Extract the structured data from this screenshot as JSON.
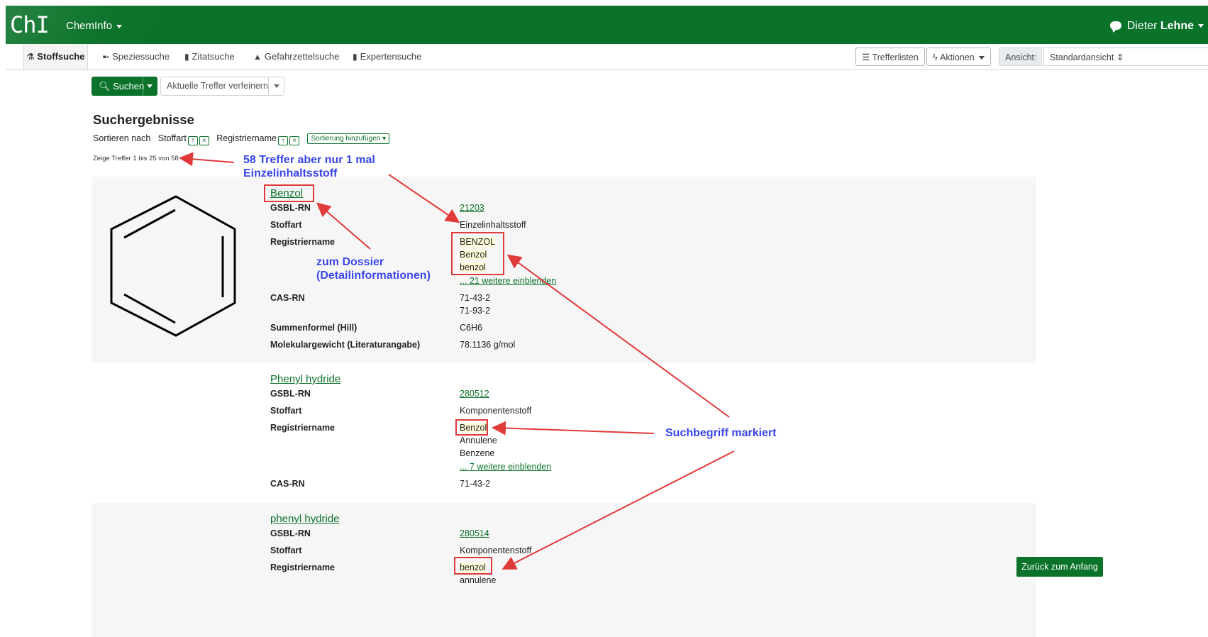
{
  "header": {
    "logo": "ChI",
    "brand": "ChemInfo",
    "user_first": "Dieter",
    "user_last": "Lehne"
  },
  "tabs": [
    {
      "label": "Stoffsuche",
      "icon": "flask-icon"
    },
    {
      "label": "Speziessuche",
      "icon": "fish-icon"
    },
    {
      "label": "Zitatsuche",
      "icon": "book-icon"
    },
    {
      "label": "Gefahrzettelsuche",
      "icon": "warning-icon"
    },
    {
      "label": "Expertensuche",
      "icon": "book-icon"
    }
  ],
  "toolbar": {
    "trefferlisten": "Trefferlisten",
    "aktionen": "Aktionen",
    "ansicht_label": "Ansicht:",
    "ansicht_value": "Standardansicht"
  },
  "search": {
    "button": "Suchen",
    "refine": "Aktuelle Treffer verfeinern"
  },
  "results_header": {
    "title": "Suchergebnisse",
    "sort_by": "Sortieren nach",
    "sort1": "Stoffart",
    "sort2": "Registriername",
    "add_sort": "Sortierung hinzufügen",
    "count": "Zeige Treffer 1 bis 25 von 58"
  },
  "results": [
    {
      "title": "Benzol",
      "rows": [
        {
          "label": "GSBL-RN",
          "values": [
            "21203"
          ]
        },
        {
          "label": "Stoffart",
          "values": [
            "Einzelinhaltsstoff"
          ]
        },
        {
          "label": "Registriername",
          "values": [
            "BENZOL",
            "Benzol",
            "benzol"
          ],
          "more": "... 21 weitere einblenden"
        },
        {
          "label": "CAS-RN",
          "values": [
            "71-43-2",
            "71-93-2"
          ]
        },
        {
          "label": "Summenformel (Hill)",
          "values": [
            "C6H6"
          ]
        },
        {
          "label": "Molekulargewicht (Literaturangabe)",
          "values": [
            "78.1136 g/mol"
          ]
        }
      ]
    },
    {
      "title": "Phenyl hydride",
      "rows": [
        {
          "label": "GSBL-RN",
          "values": [
            "280512"
          ]
        },
        {
          "label": "Stoffart",
          "values": [
            "Komponentenstoff"
          ]
        },
        {
          "label": "Registriername",
          "values": [
            "Benzol",
            "Annulene",
            "Benzene"
          ],
          "more": "... 7 weitere einblenden"
        },
        {
          "label": "CAS-RN",
          "values": [
            "71-43-2"
          ]
        }
      ]
    },
    {
      "title": "phenyl hydride",
      "rows": [
        {
          "label": "GSBL-RN",
          "values": [
            "280514"
          ]
        },
        {
          "label": "Stoffart",
          "values": [
            "Komponentenstoff"
          ]
        },
        {
          "label": "Registriername",
          "values": [
            "benzol",
            "annulene"
          ]
        }
      ]
    }
  ],
  "annotations": {
    "a1_line1": "58 Treffer aber nur 1 mal",
    "a1_line2": "Einzelinhaltsstoff",
    "a2_line1": "zum Dossier",
    "a2_line2": "(Detailinformationen)",
    "a3": "Suchbegriff markiert"
  },
  "back_button": "Zurück zum Anfang",
  "colors": {
    "brand_green": "#0a7229",
    "annotation_blue": "#3845e8",
    "annotation_red": "#e03a3a"
  }
}
